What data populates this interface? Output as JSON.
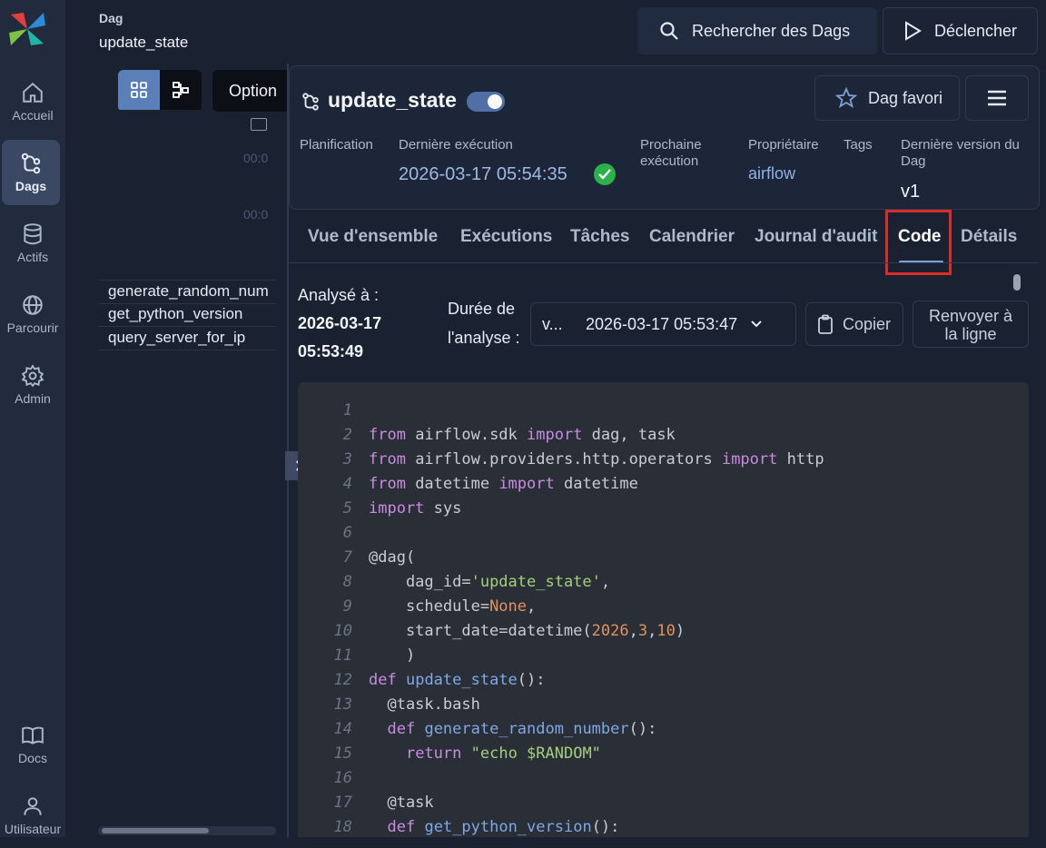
{
  "nav": {
    "items": [
      {
        "label": "Accueil",
        "icon": "home-icon"
      },
      {
        "label": "Dags",
        "icon": "dags-icon",
        "active": true
      },
      {
        "label": "Actifs",
        "icon": "database-icon"
      },
      {
        "label": "Parcourir",
        "icon": "globe-icon"
      },
      {
        "label": "Admin",
        "icon": "gear-icon"
      }
    ],
    "bottom": [
      {
        "label": "Docs",
        "icon": "book-icon"
      },
      {
        "label": "Utilisateur",
        "icon": "user-icon"
      }
    ]
  },
  "breadcrumb": {
    "label": "Dag",
    "name": "update_state"
  },
  "pane": {
    "options_label": "Option",
    "times": [
      "00:0",
      "00:0"
    ],
    "tasks": [
      "generate_random_num",
      "get_python_version",
      "query_server_for_ip"
    ]
  },
  "header": {
    "search_label": "Rechercher des Dags",
    "trigger_label": "Déclencher"
  },
  "dag": {
    "title": "update_state",
    "favorite_label": "Dag favori",
    "meta": {
      "planification": "Planification",
      "derniere_execution": "Dernière exécution",
      "derniere_execution_value": "2026-03-17 05:54:35",
      "prochaine_execution": "Prochaine exécution",
      "proprietaire": "Propriétaire",
      "proprietaire_value": "airflow",
      "tags": "Tags",
      "derniere_version": "Dernière version du Dag",
      "derniere_version_value": "v1"
    }
  },
  "tabs": [
    "Vue d'ensemble",
    "Exécutions",
    "Tâches",
    "Calendrier",
    "Journal d'audit",
    "Code",
    "Détails"
  ],
  "active_tab": "Code",
  "code_toolbar": {
    "parsed_label": "Analysé à :",
    "parsed_value_date": "2026-03-17",
    "parsed_value_time": "05:53:49",
    "duration_label_1": "Durée de",
    "duration_label_2": "l'analyse :",
    "version_prefix": "v...",
    "version_value": "2026-03-17 05:53:47",
    "copy_label": "Copier",
    "wrap_label_1": "Renvoyer à",
    "wrap_label_2": "la ligne"
  },
  "code": [
    "",
    "from airflow.sdk import dag, task",
    "from airflow.providers.http.operators import http",
    "from datetime import datetime",
    "import sys",
    "",
    "@dag(",
    "    dag_id='update_state',",
    "    schedule=None,",
    "    start_date=datetime(2026,3,10)",
    "    )",
    "def update_state():",
    "  @task.bash",
    "  def generate_random_number():",
    "    return \"echo $RANDOM\"",
    "",
    "  @task",
    "  def get_python_version():"
  ],
  "colors": {
    "accent": "#5b84c4",
    "highlight": "#d92d2a",
    "success": "#2bb04a"
  }
}
